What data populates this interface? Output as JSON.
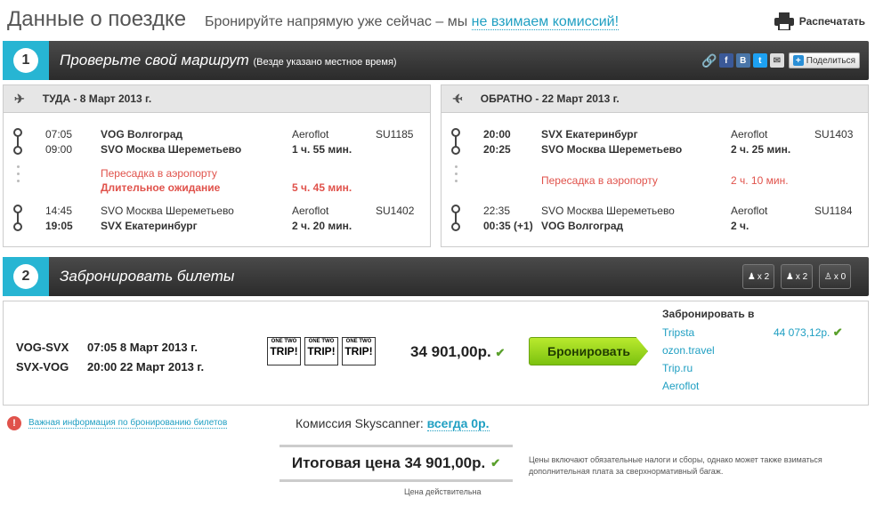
{
  "header": {
    "title": "Данные о поездке",
    "subtitle": "Бронируйте напрямую уже сейчас – мы",
    "subtitle_link": "не взимаем комиссий!",
    "print_label": "Распечатать"
  },
  "step1": {
    "number": "1",
    "title": "Проверьте свой маршрут",
    "note": "(Везде указано местное время)",
    "share_label": "Поделиться"
  },
  "outbound": {
    "heading": "ТУДА - 8 Март 2013 г.",
    "seg1": {
      "dep_time": "07:05",
      "dep_airport": "VOG Волгоград",
      "airline": "Aeroflot",
      "flight": "SU1185",
      "arr_time": "09:00",
      "arr_airport": "SVO Москва Шереметьево",
      "duration": "1 ч. 55 мин."
    },
    "layover": {
      "text": "Пересадка в аэропорту",
      "warning": "Длительное ожидание",
      "duration": "5 ч. 45 мин."
    },
    "seg2": {
      "dep_time": "14:45",
      "dep_airport": "SVO Москва Шереметьево",
      "airline": "Aeroflot",
      "flight": "SU1402",
      "arr_time": "19:05",
      "arr_airport": "SVX Екатеринбург",
      "duration": "2 ч. 20 мин."
    }
  },
  "inbound": {
    "heading": "ОБРАТНО - 22 Март 2013 г.",
    "seg1": {
      "dep_time": "20:00",
      "dep_airport": "SVX Екатеринбург",
      "airline": "Aeroflot",
      "flight": "SU1403",
      "arr_time": "20:25",
      "arr_airport": "SVO Москва Шереметьево",
      "duration": "2 ч. 25 мин."
    },
    "layover": {
      "text": "Пересадка в аэропорту",
      "duration": "2 ч. 10 мин."
    },
    "seg2": {
      "dep_time": "22:35",
      "dep_airport": "SVO Москва Шереметьево",
      "airline": "Aeroflot",
      "flight": "SU1184",
      "arr_time": "00:35 (+1)",
      "arr_airport": "VOG Волгоград",
      "duration": "2 ч."
    }
  },
  "step2": {
    "number": "2",
    "title": "Забронировать билеты",
    "pax": [
      {
        "icon": "adult-icon",
        "count": "x 2"
      },
      {
        "icon": "child-icon",
        "count": "x 2"
      },
      {
        "icon": "infant-icon",
        "count": "x 0"
      }
    ]
  },
  "booking": {
    "leg1_route": "VOG-SVX",
    "leg1_date": "07:05 8 Март 2013 г.",
    "leg2_route": "SVX-VOG",
    "leg2_date": "20:00 22 Март 2013 г.",
    "logo_top": "ONE TWO",
    "logo_word": "TRIP!",
    "price": "34 901,00р.",
    "book_label": "Бронировать",
    "providers_title": "Забронировать в",
    "providers": [
      "Tripsta",
      "ozon.travel",
      "Trip.ru",
      "Aeroflot"
    ],
    "alt_price": "44 073,12р."
  },
  "footer": {
    "info_link": "Важная информация по бронированию билетов",
    "commission_label": "Комиссия Skyscanner:",
    "commission_value": "всегда 0р.",
    "total": "Итоговая цена 34 901,00р.",
    "valid": "Цена действительна",
    "note": "Цены включают обязательные налоги и сборы, однако может также взиматься дополнительная плата за сверхнормативный багаж."
  },
  "colors": {
    "accent": "#27b5d3",
    "link": "#1f9fc2",
    "warning": "#e0524b",
    "book_green": "#7cc20f",
    "check": "#5aa02c"
  }
}
